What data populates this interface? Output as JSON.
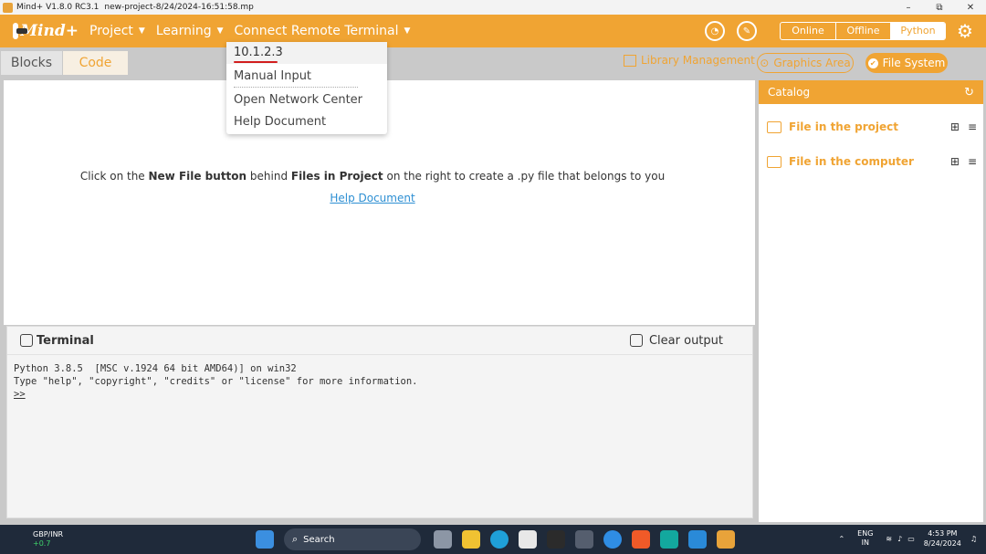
{
  "window": {
    "title": "Mind+ V1.8.0 RC3.1",
    "filename": "new-project-8/24/2024-16:51:58.mp",
    "controls": [
      "–",
      "⧉",
      "✕"
    ]
  },
  "header": {
    "logo": "Mind+",
    "menu": [
      {
        "label": "Project"
      },
      {
        "label": "Learning"
      },
      {
        "label": "Connect Remote Terminal"
      }
    ],
    "modes": [
      "Online",
      "Offline",
      "Python"
    ],
    "active_mode": "Python"
  },
  "dropdown": {
    "items": [
      "10.1.2.3",
      "Manual Input",
      "Open Network Center",
      "Help Document"
    ]
  },
  "subbar": {
    "tabs": [
      "Blocks",
      "Code"
    ],
    "library": "Library Management",
    "graphics": "Graphics Area",
    "filesystem": "File System"
  },
  "editor": {
    "message_prefix": "Click on the ",
    "message_bold1": "New File button",
    "message_mid": " behind ",
    "message_bold2": "Files in Project",
    "message_suffix": " on the right to create a .py file that belongs to you",
    "help_link": "Help Document"
  },
  "terminal": {
    "title": "Terminal",
    "clear": "Clear output",
    "line1": "Python 3.8.5  [MSC v.1924 64 bit AMD64)] on win32",
    "line2": "Type \"help\", \"copyright\", \"credits\" or \"license\" for more information.",
    "prompt": ">>"
  },
  "catalog": {
    "title": "Catalog",
    "items": [
      "File in the project",
      "File in the computer"
    ]
  },
  "taskbar": {
    "weather_label": "GBP/INR",
    "weather_change": "+0.7",
    "search": "Search",
    "lang1": "ENG",
    "lang2": "IN",
    "time": "4:53 PM",
    "date": "8/24/2024"
  },
  "colors": {
    "accent": "#f0a433",
    "link": "#2d8fd3",
    "taskbar": "#1f2a3a"
  }
}
